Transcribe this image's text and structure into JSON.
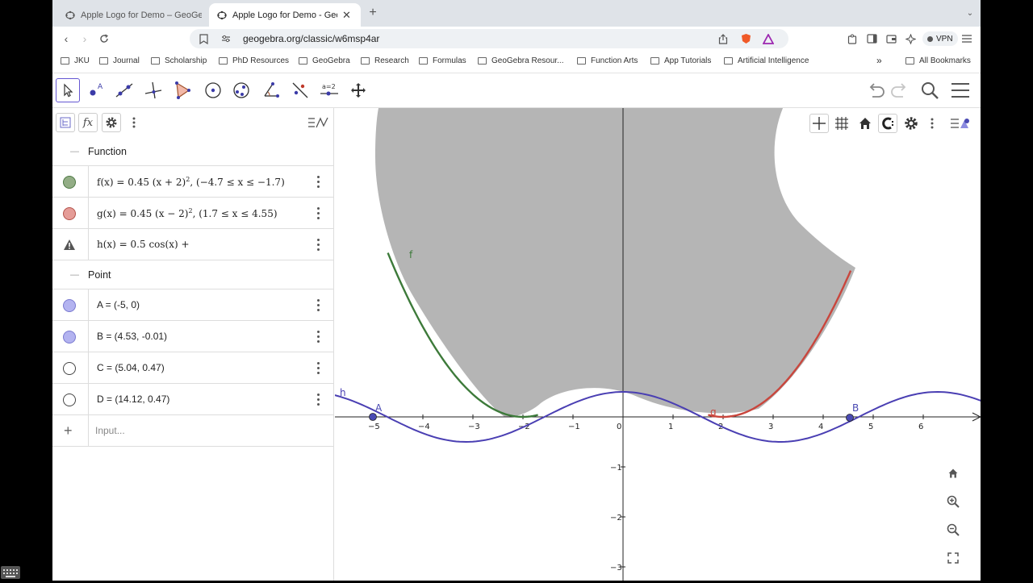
{
  "browser": {
    "tabs": [
      {
        "label": "Apple Logo for Demo – GeoGebra",
        "active": false
      },
      {
        "label": "Apple Logo for Demo - GeoG",
        "active": true
      }
    ],
    "url": "geogebra.org/classic/w6msp4ar",
    "vpn_label": "VPN",
    "bookmarks": [
      "JKU",
      "Journal",
      "Scholarship",
      "PhD Resources",
      "GeoGebra",
      "Research",
      "Formulas",
      "GeoGebra Resour...",
      "Function Arts",
      "App Tutorials",
      "Artificial Intelligence"
    ],
    "all_bookmarks": "All Bookmarks",
    "more": "»"
  },
  "toolbar": {
    "tools": [
      "move-tool",
      "point-tool",
      "line-tool",
      "perpendicular-line-tool",
      "polygon-tool",
      "circle-tool",
      "conic-tool",
      "angle-tool",
      "reflect-tool",
      "slider-tool",
      "move-graphics-tool"
    ],
    "slider_label": "a=2"
  },
  "algebra": {
    "sections": {
      "function": "Function",
      "point": "Point"
    },
    "rows": [
      {
        "name": "f",
        "expr": "f(x) = 0.45 (x + 2)",
        "power": "2",
        "domain": ",   (−4.7 ≤ x ≤ −1.7)",
        "color": "#2e7d32",
        "fill": "#93ad86"
      },
      {
        "name": "g",
        "expr": "g(x) = 0.45 (x − 2)",
        "power": "2",
        "domain": ",   (1.7 ≤ x ≤ 4.55)",
        "color": "#c62828",
        "fill": "#e59c97"
      },
      {
        "name": "h",
        "expr": "h(x) = 0.5 cos(x) +",
        "power": "",
        "domain": "",
        "color": "#444444",
        "fill": "warning"
      },
      {
        "name": "A",
        "expr": "A = (-5, 0)",
        "color": "#4a4aa8",
        "fill": "#b3b3f0"
      },
      {
        "name": "B",
        "expr": "B = (4.53, -0.01)",
        "color": "#4a4aa8",
        "fill": "#b3b3f0"
      },
      {
        "name": "C",
        "expr": "C = (5.04, 0.47)",
        "color": "#444444",
        "fill": "#ffffff"
      },
      {
        "name": "D",
        "expr": "D = (14.12, 0.47)",
        "color": "#444444",
        "fill": "#ffffff"
      }
    ],
    "input_placeholder": "Input..."
  },
  "graphics": {
    "x_ticks": [
      "−5",
      "−4",
      "−3",
      "−2",
      "−1",
      "0",
      "1",
      "2",
      "3",
      "4",
      "5",
      "6"
    ],
    "y_ticks": [
      "−1",
      "−2",
      "−3"
    ],
    "labels": {
      "f": "f",
      "g": "g",
      "h": "h",
      "A": "A",
      "B": "B"
    },
    "colors": {
      "f": "#3d7a3a",
      "g": "#c9463d",
      "h": "#4a3fb3",
      "apple": "#b5b5b5",
      "axis": "#222222"
    }
  }
}
